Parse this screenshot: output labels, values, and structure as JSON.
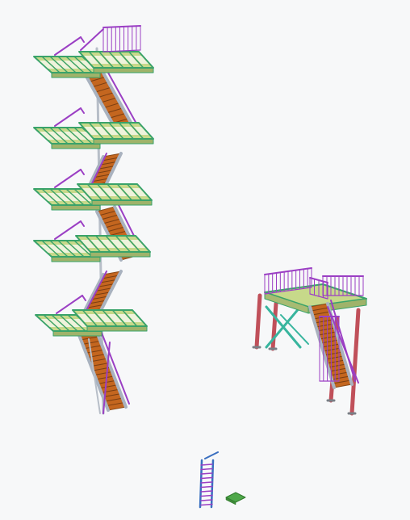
{
  "viewport": {
    "background": "#f7f8f9",
    "objects": [
      {
        "name": "multi-level-stair-tower",
        "landings": 5,
        "flights": 5
      },
      {
        "name": "elevated-platform-with-stair",
        "legs": 4
      },
      {
        "name": "vertical-ladder"
      },
      {
        "name": "floor-plate"
      }
    ]
  },
  "colors": {
    "handrail": "#9b3fc4",
    "landing_deck": "#c7d98a",
    "landing_edge": "#3aa36a",
    "stair_tread": "#c4661f",
    "stringer": "#a9b2bf",
    "column": "#c0505a",
    "bracing": "#38b59e",
    "ladder_rail": "#3a6fc0",
    "plate": "#4fa84a"
  }
}
